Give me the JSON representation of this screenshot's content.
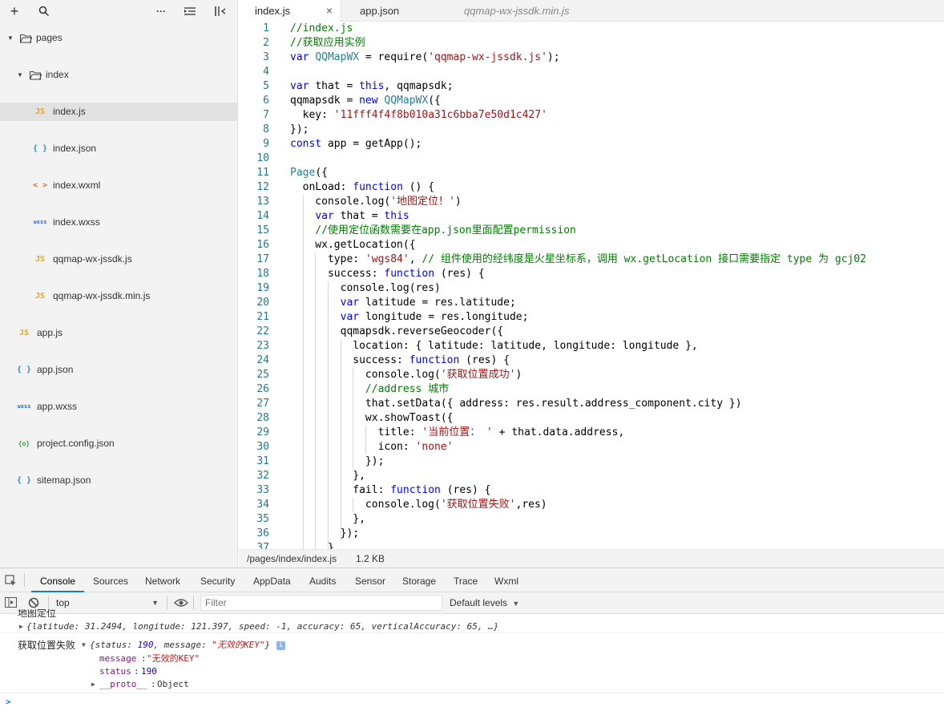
{
  "sidebar": {
    "toolbar": {
      "add": "+",
      "search": "search-icon",
      "more": "···",
      "collapse": "collapse-icon",
      "layout": "layout-icon"
    },
    "tree": [
      {
        "label": "pages",
        "type": "folder"
      },
      {
        "label": "index",
        "type": "folder"
      },
      {
        "label": "index.js",
        "type": "js",
        "selected": true
      },
      {
        "label": "index.json",
        "type": "json"
      },
      {
        "label": "index.wxml",
        "type": "wxml"
      },
      {
        "label": "index.wxss",
        "type": "wxss"
      },
      {
        "label": "qqmap-wx-jssdk.js",
        "type": "js"
      },
      {
        "label": "qqmap-wx-jssdk.min.js",
        "type": "js"
      },
      {
        "label": "app.js",
        "type": "js"
      },
      {
        "label": "app.json",
        "type": "json"
      },
      {
        "label": "app.wxss",
        "type": "wxss"
      },
      {
        "label": "project.config.json",
        "type": "config"
      },
      {
        "label": "sitemap.json",
        "type": "json"
      }
    ],
    "icon_glyphs": {
      "js": "JS",
      "json": "{ }",
      "wxml": "< >",
      "wxss": "wxss",
      "config": "{o}"
    }
  },
  "editor": {
    "tabs": [
      {
        "label": "index.js",
        "close": "×"
      },
      {
        "label": "app.json"
      },
      {
        "label": "qqmap-wx-jssdk.min.js"
      }
    ],
    "lines": [
      [
        [
          "c",
          "//index.js"
        ]
      ],
      [
        [
          "c",
          "//获取应用实例"
        ]
      ],
      [
        [
          "k",
          "var "
        ],
        [
          "v",
          "QQMapWX"
        ],
        [
          "t",
          " = require("
        ],
        [
          "s",
          "'qqmap-wx-jssdk.js'"
        ],
        [
          "t",
          ");"
        ]
      ],
      [],
      [
        [
          "k",
          "var "
        ],
        [
          "t",
          "that = "
        ],
        [
          "k",
          "this"
        ],
        [
          "t",
          ", qqmapsdk;"
        ]
      ],
      [
        [
          "t",
          "qqmapsdk = "
        ],
        [
          "k",
          "new "
        ],
        [
          "v",
          "QQMapWX"
        ],
        [
          "t",
          "({"
        ]
      ],
      [
        [
          "t",
          "  key: "
        ],
        [
          "s",
          "'11fff4f4f8b010a31c6bba7e50d1c427'"
        ]
      ],
      [
        [
          "t",
          "});"
        ]
      ],
      [
        [
          "k",
          "const "
        ],
        [
          "t",
          "app = getApp();"
        ]
      ],
      [],
      [
        [
          "v",
          "Page"
        ],
        [
          "t",
          "({"
        ]
      ],
      [
        [
          "t",
          "  onLoad: "
        ],
        [
          "k",
          "function "
        ],
        [
          "t",
          "() {"
        ]
      ],
      [
        [
          "t",
          "    console.log("
        ],
        [
          "s",
          "'地图定位！'"
        ],
        [
          "t",
          ")"
        ]
      ],
      [
        [
          "t",
          "    "
        ],
        [
          "k",
          "var "
        ],
        [
          "t",
          "that = "
        ],
        [
          "k",
          "this"
        ]
      ],
      [
        [
          "t",
          "    "
        ],
        [
          "c",
          "//使用定位函数需要在app.json里面配置permission"
        ]
      ],
      [
        [
          "t",
          "    wx.getLocation({"
        ]
      ],
      [
        [
          "t",
          "      type: "
        ],
        [
          "s",
          "'wgs84'"
        ],
        [
          "t",
          ", "
        ],
        [
          "c",
          "// 组件使用的经纬度是火星坐标系，调用 wx.getLocation 接口需要指定 type 为 gcj02"
        ]
      ],
      [
        [
          "t",
          "      success: "
        ],
        [
          "k",
          "function "
        ],
        [
          "t",
          "(res) {"
        ]
      ],
      [
        [
          "t",
          "        console.log(res)"
        ]
      ],
      [
        [
          "t",
          "        "
        ],
        [
          "k",
          "var "
        ],
        [
          "t",
          "latitude = res.latitude;"
        ]
      ],
      [
        [
          "t",
          "        "
        ],
        [
          "k",
          "var "
        ],
        [
          "t",
          "longitude = res.longitude;"
        ]
      ],
      [
        [
          "t",
          "        qqmapsdk.reverseGeocoder({"
        ]
      ],
      [
        [
          "t",
          "          location: { latitude: latitude, longitude: longitude },"
        ]
      ],
      [
        [
          "t",
          "          success: "
        ],
        [
          "k",
          "function "
        ],
        [
          "t",
          "(res) {"
        ]
      ],
      [
        [
          "t",
          "            console.log("
        ],
        [
          "s",
          "'获取位置成功'"
        ],
        [
          "t",
          ")"
        ]
      ],
      [
        [
          "t",
          "            "
        ],
        [
          "c",
          "//address 城市"
        ]
      ],
      [
        [
          "t",
          "            that.setData({ address: res.result.address_component.city })"
        ]
      ],
      [
        [
          "t",
          "            wx.showToast({"
        ]
      ],
      [
        [
          "t",
          "              title: "
        ],
        [
          "s",
          "'当前位置： '"
        ],
        [
          "t",
          " + that.data.address,"
        ]
      ],
      [
        [
          "t",
          "              icon: "
        ],
        [
          "s",
          "'none'"
        ]
      ],
      [
        [
          "t",
          "            });"
        ]
      ],
      [
        [
          "t",
          "          },"
        ]
      ],
      [
        [
          "t",
          "          fail: "
        ],
        [
          "k",
          "function "
        ],
        [
          "t",
          "(res) {"
        ]
      ],
      [
        [
          "t",
          "            console.log("
        ],
        [
          "s",
          "'获取位置失败'"
        ],
        [
          "t",
          ",res)"
        ]
      ],
      [
        [
          "t",
          "          },"
        ]
      ],
      [
        [
          "t",
          "        });"
        ]
      ],
      [
        [
          "t",
          "      }"
        ]
      ]
    ],
    "status": {
      "path": "/pages/index/index.js",
      "size": "1.2 KB"
    }
  },
  "devtools": {
    "tabs": [
      "Console",
      "Sources",
      "Network",
      "Security",
      "AppData",
      "Audits",
      "Sensor",
      "Storage",
      "Trace",
      "Wxml"
    ],
    "active_tab": "Console",
    "context": "top",
    "filter_placeholder": "Filter",
    "levels": "Default levels",
    "console": {
      "partial_text": "地图定位",
      "location_object": "{latitude: 31.2494, longitude: 121.397, speed: -1, accuracy: 65, verticalAccuracy: 65, …}",
      "fail_label": "获取位置失败",
      "fail_object_prefix": "{status: ",
      "fail_status": "190",
      "fail_mid": ", message: ",
      "fail_message": "\"无效的KEY\"",
      "fail_suffix": "}",
      "info_badge": "i",
      "props": [
        {
          "key": "message",
          "value": "\"无效的KEY\""
        },
        {
          "key": "status",
          "value": "190"
        },
        {
          "key": "__proto__",
          "value": "Object"
        }
      ],
      "prompt": ">"
    }
  },
  "colors": {
    "accent": "#1a73e8",
    "keyword": "#0000ff",
    "string": "#a31515",
    "comment": "#008000"
  }
}
